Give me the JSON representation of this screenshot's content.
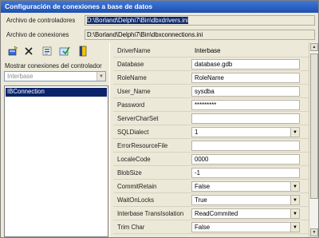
{
  "window": {
    "title": "Configuración de conexiones a base de datos"
  },
  "paths": {
    "drivers_label": "Archivo de controladores",
    "drivers_value": "D:\\Borland\\Delphi7\\Bin\\dbxdrivers.ini",
    "connections_label": "Archivo de conexiones",
    "connections_value": "D:\\Borland\\Delphi7\\Bin\\dbxconnections.ini"
  },
  "toolbar": {
    "buttons": [
      {
        "name": "new-connection-icon"
      },
      {
        "name": "delete-icon"
      },
      {
        "name": "rename-icon"
      },
      {
        "name": "test-connection-icon"
      },
      {
        "name": "exit-door-icon"
      }
    ]
  },
  "left": {
    "filter_label": "Mostrar conexiones del controlador",
    "filter_value": "Interbase",
    "connections": [
      "IBConnection"
    ]
  },
  "properties": [
    {
      "name": "DriverName",
      "value": "Interbase",
      "kind": "readonly"
    },
    {
      "name": "Database",
      "value": "database.gdb",
      "kind": "text"
    },
    {
      "name": "RoleName",
      "value": "RoleName",
      "kind": "text"
    },
    {
      "name": "User_Name",
      "value": "sysdba",
      "kind": "text"
    },
    {
      "name": "Password",
      "value": "*********",
      "kind": "text"
    },
    {
      "name": "ServerCharSet",
      "value": "",
      "kind": "text"
    },
    {
      "name": "SQLDialect",
      "value": "1",
      "kind": "select"
    },
    {
      "name": "ErrorResourceFile",
      "value": "",
      "kind": "text"
    },
    {
      "name": "LocaleCode",
      "value": "0000",
      "kind": "text"
    },
    {
      "name": "BlobSize",
      "value": "-1",
      "kind": "text"
    },
    {
      "name": "CommitRetain",
      "value": "False",
      "kind": "select"
    },
    {
      "name": "WaitOnLocks",
      "value": "True",
      "kind": "select"
    },
    {
      "name": "Interbase TransIsolation",
      "value": "ReadCommited",
      "kind": "select"
    },
    {
      "name": "Trim Char",
      "value": "False",
      "kind": "select"
    }
  ]
}
